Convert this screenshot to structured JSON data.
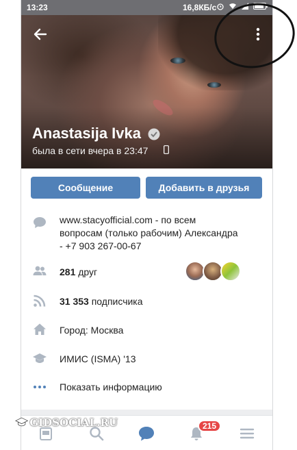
{
  "status_bar": {
    "time": "13:23",
    "speed": "16,8КБ/с"
  },
  "profile": {
    "name": "Anastasija Ivka",
    "last_seen": "была в сети вчера в 23:47"
  },
  "actions": {
    "message_label": "Сообщение",
    "add_friend_label": "Добавить в друзья"
  },
  "info": {
    "site_line1": "www.stacyofficial.com - по всем",
    "site_line2": "вопросам (только рабочим) Александра",
    "site_line3": "- +7 903 267-00-67",
    "friends_count": "281",
    "friends_label": "друг",
    "followers_count": "31 353",
    "followers_label": "подписчика",
    "city": "Город: Москва",
    "education": "ИМИС (ISMA) '13",
    "show_more": "Показать информацию"
  },
  "bottom_nav": {
    "notifications_badge": "215"
  },
  "watermark": "GIDSOCIAL.RU",
  "colors": {
    "accent": "#5181b8",
    "link": "#2a5885",
    "badge": "#e64646"
  }
}
